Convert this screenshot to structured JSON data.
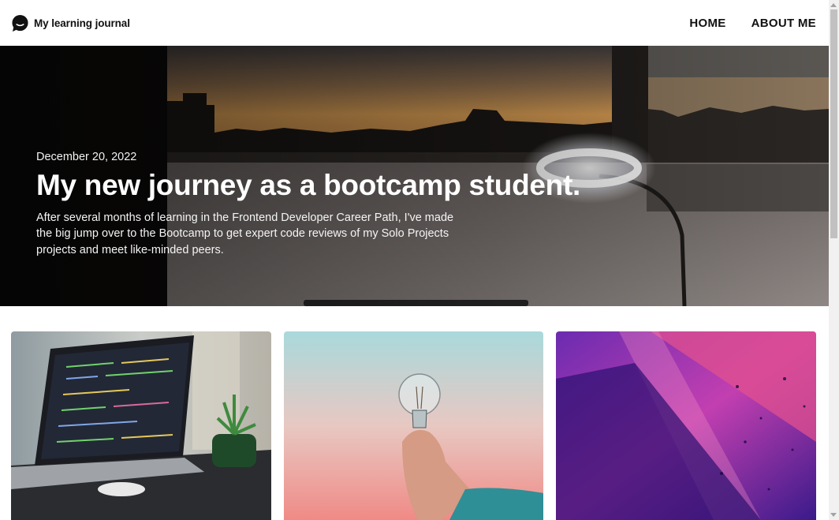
{
  "header": {
    "brand_name": "My learning journal",
    "logo_icon": "speech-bubble-icon",
    "nav": [
      {
        "label": "HOME"
      },
      {
        "label": "ABOUT ME"
      }
    ]
  },
  "hero": {
    "image": "city-sunset-window-lamp-photo",
    "date": "December 20, 2022",
    "title": "My new journey as a bootcamp student.",
    "body": "After several months of learning in the Frontend Developer Career Path, I've made the big jump over to the Bootcamp to get expert code reviews of my Solo Projects projects and meet like-minded peers."
  },
  "cards": [
    {
      "image": "laptop-code-photo"
    },
    {
      "image": "lightbulb-hand-photo"
    },
    {
      "image": "purple-abstract-photo"
    }
  ],
  "colors": {
    "header_bg": "#ffffff",
    "hero_text": "#ffffff",
    "text": "#111111"
  }
}
